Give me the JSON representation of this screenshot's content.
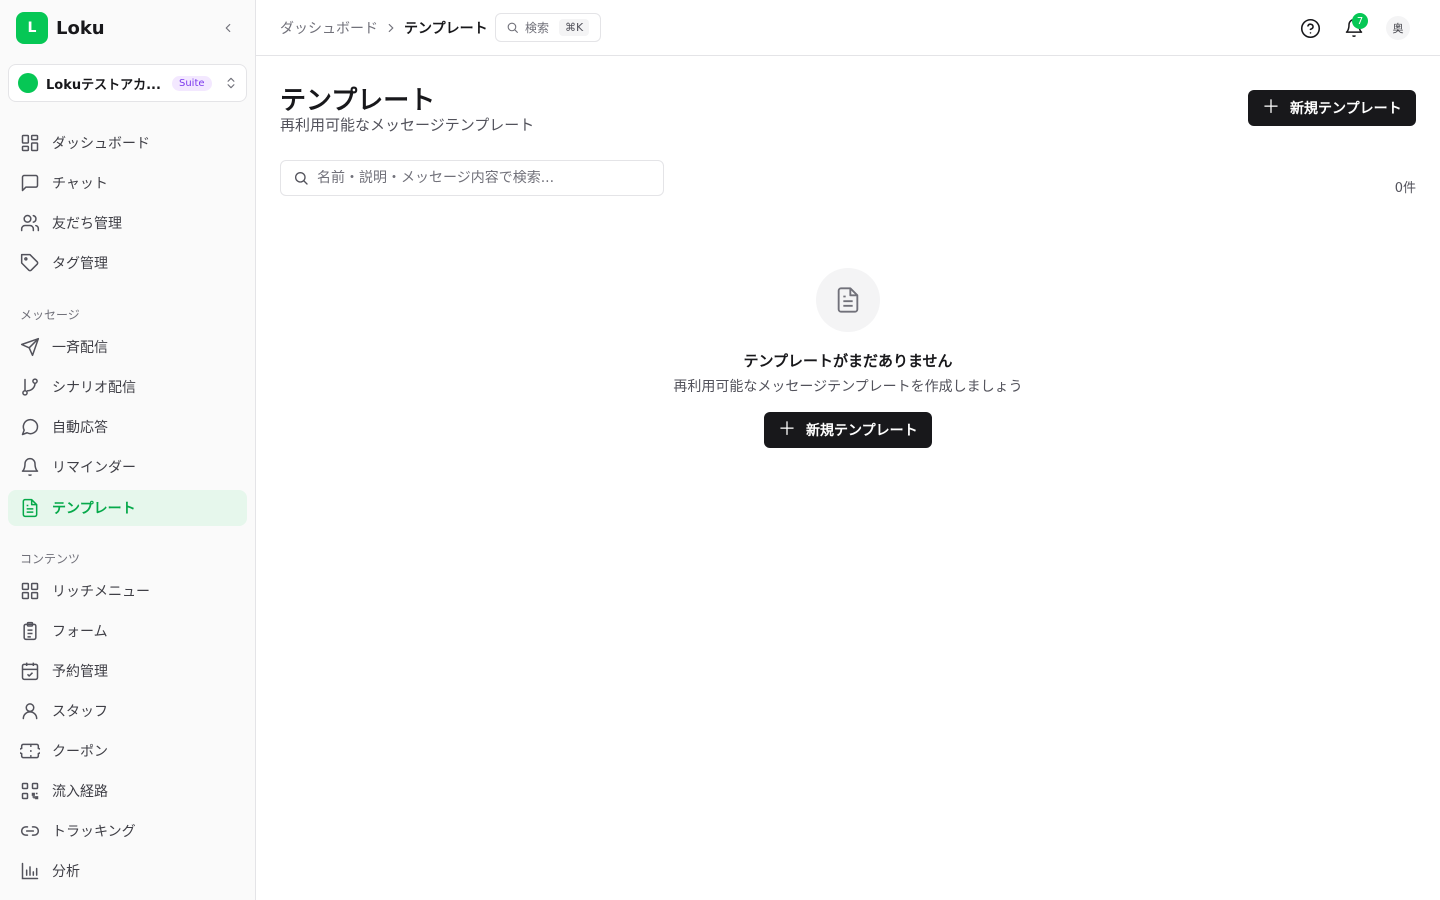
{
  "brand": {
    "logo_letter": "L",
    "name": "Loku"
  },
  "account": {
    "name": "Lokuテストアカ...",
    "badge": "Suite"
  },
  "nav": {
    "main": [
      {
        "label": "ダッシュボード",
        "icon": "dashboard-icon"
      },
      {
        "label": "チャット",
        "icon": "chat-icon"
      },
      {
        "label": "友だち管理",
        "icon": "users-icon"
      },
      {
        "label": "タグ管理",
        "icon": "tag-icon"
      }
    ],
    "message_section": "メッセージ",
    "message": [
      {
        "label": "一斉配信",
        "icon": "send-icon"
      },
      {
        "label": "シナリオ配信",
        "icon": "branch-icon"
      },
      {
        "label": "自動応答",
        "icon": "message-circle-icon"
      },
      {
        "label": "リマインダー",
        "icon": "bell-icon"
      },
      {
        "label": "テンプレート",
        "icon": "file-text-icon",
        "active": true
      }
    ],
    "content_section": "コンテンツ",
    "content": [
      {
        "label": "リッチメニュー",
        "icon": "grid-icon"
      },
      {
        "label": "フォーム",
        "icon": "clipboard-icon"
      },
      {
        "label": "予約管理",
        "icon": "calendar-check-icon"
      },
      {
        "label": "スタッフ",
        "icon": "user-icon"
      },
      {
        "label": "クーポン",
        "icon": "ticket-icon"
      },
      {
        "label": "流入経路",
        "icon": "qr-code-icon"
      },
      {
        "label": "トラッキング",
        "icon": "link-icon"
      },
      {
        "label": "分析",
        "icon": "bar-chart-icon"
      }
    ]
  },
  "header": {
    "breadcrumb": [
      "ダッシュボード",
      "テンプレート"
    ],
    "search_label": "検索",
    "search_shortcut": "⌘K",
    "notification_count": "7",
    "avatar_text": "奥"
  },
  "page": {
    "title": "テンプレート",
    "subtitle": "再利用可能なメッセージテンプレート",
    "new_button": "新規テンプレート",
    "search_placeholder": "名前・説明・メッセージ内容で検索...",
    "count": "0件"
  },
  "empty_state": {
    "icon": "file-text-icon",
    "title": "テンプレートがまだありません",
    "description": "再利用可能なメッセージテンプレートを作成しましょう",
    "button": "新規テンプレート"
  },
  "colors": {
    "brand": "#06c755",
    "primary_button": "#18181b",
    "active_bg": "#e6f7ec",
    "active_text": "#06a94a",
    "suite_badge": "#7c3aed"
  }
}
